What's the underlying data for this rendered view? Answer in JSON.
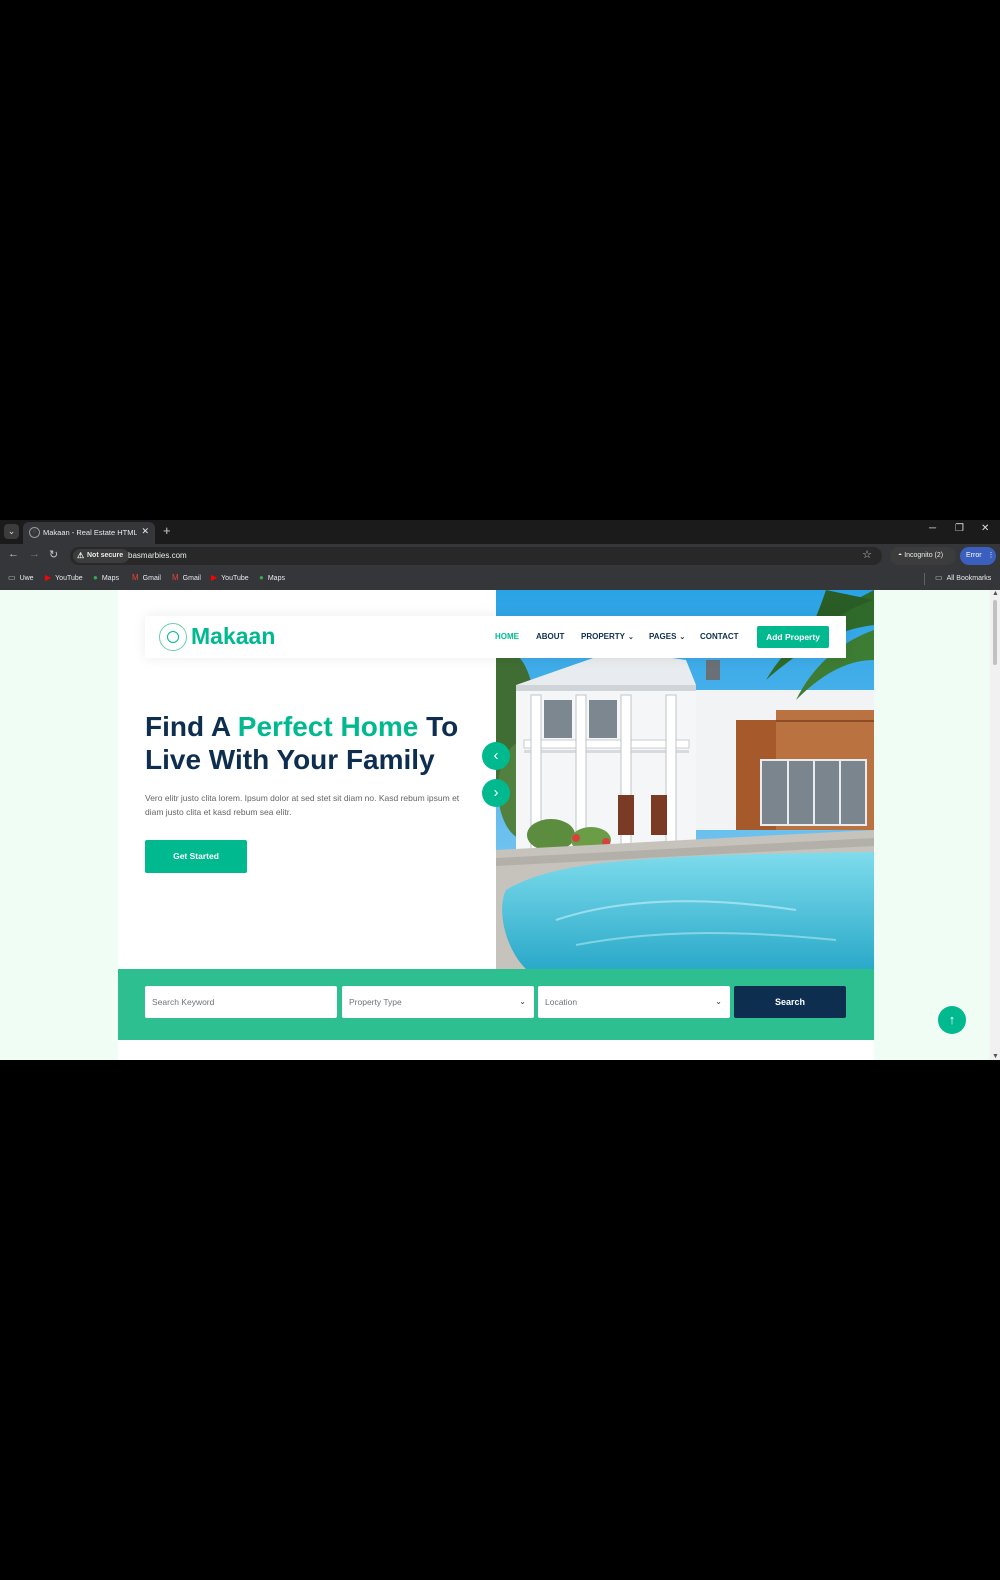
{
  "browser": {
    "tab_title": "Makaan - Real Estate HTML Tem",
    "security_label": "Not secure",
    "url": "basmarbies.com",
    "incognito_label": "Incognito (2)",
    "error_label": "Error",
    "bookmarks": [
      "Uwe",
      "YouTube",
      "Maps",
      "Gmail",
      "Gmail",
      "YouTube",
      "Maps"
    ],
    "all_bookmarks": "All Bookmarks"
  },
  "site": {
    "brand": "Makaan",
    "nav": {
      "home": "HOME",
      "about": "ABOUT",
      "property": "PROPERTY",
      "pages": "PAGES",
      "contact": "CONTACT",
      "add_property": "Add Property"
    },
    "hero": {
      "title_part1": "Find A ",
      "title_accent": "Perfect Home",
      "title_part2": " To Live With Your Family",
      "lead": "Vero elitr justo clita lorem. Ipsum dolor at sed stet sit diam no. Kasd rebum ipsum et diam justo clita et kasd rebum sea elitr.",
      "cta": "Get Started"
    },
    "search": {
      "keyword_placeholder": "Search Keyword",
      "property_type": "Property Type",
      "location": "Location",
      "button": "Search"
    }
  },
  "colors": {
    "accent": "#00b98e",
    "navy": "#0e2e50",
    "page_bg": "#effdf5"
  },
  "icons": [
    "tab-search-icon",
    "globe-icon",
    "close-icon",
    "plus-icon",
    "back-icon",
    "forward-icon",
    "reload-icon",
    "warning-icon",
    "star-icon",
    "incognito-icon",
    "kebab-icon",
    "folder-icon",
    "youtube-icon",
    "maps-icon",
    "gmail-icon",
    "logo-icon",
    "chevron-down-icon",
    "chevron-left-icon",
    "chevron-right-icon",
    "arrow-up-icon"
  ]
}
